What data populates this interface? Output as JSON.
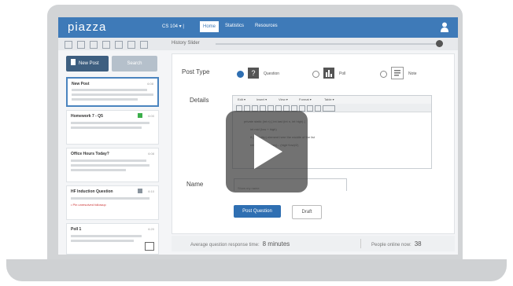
{
  "navbar": {
    "logo": "piazza",
    "class_selector": "CS 104 ▾ |",
    "home": "Home",
    "statistics": "Statistics",
    "resources": "Resources"
  },
  "toolbar": {
    "history": "History Slider"
  },
  "sidebar": {
    "new_post": "New Post",
    "search": "Search",
    "posts": [
      {
        "title": "New Post",
        "time": "6:08"
      },
      {
        "title": "Homework 7 - Q5",
        "time": "6:00"
      },
      {
        "title": "Office Hours Today?",
        "time": "6:08"
      },
      {
        "title": "HF Induction Question",
        "time": "6:10",
        "red": "• Pin unresolved followup"
      },
      {
        "title": "Poll 1",
        "time": "6:20"
      }
    ]
  },
  "form": {
    "post_type_label": "Post Type",
    "types": [
      {
        "label": "Question",
        "selected": true,
        "icon": "?"
      },
      {
        "label": "Poll",
        "selected": false,
        "icon": "poll-chart-icon"
      },
      {
        "label": "Note",
        "selected": false,
        "icon": "note-icon"
      }
    ],
    "details_label": "Details",
    "editor_menu": [
      "Edit ▾",
      "Insert ▾",
      "View ▾",
      "Format ▾",
      "Table ▾"
    ],
    "code_lines": [
      "private static (int n) { int last (int n, int high) {",
      "int mid (low + high)",
      "if (... tooltip) element here the middle of the list",
      "return ... recursion(... (high+low)/2)"
    ],
    "name_label": "Name",
    "name_placeholder": "Show my name",
    "post_button": "Post Question",
    "draft_button": "Draft"
  },
  "footer": {
    "avg_label": "Average question response time:",
    "avg_value": "8 minutes",
    "online_label": "People online now:",
    "online_value": "38"
  },
  "colors": {
    "accent": "#3e7ab8",
    "primary_button": "#2f6fb2"
  }
}
